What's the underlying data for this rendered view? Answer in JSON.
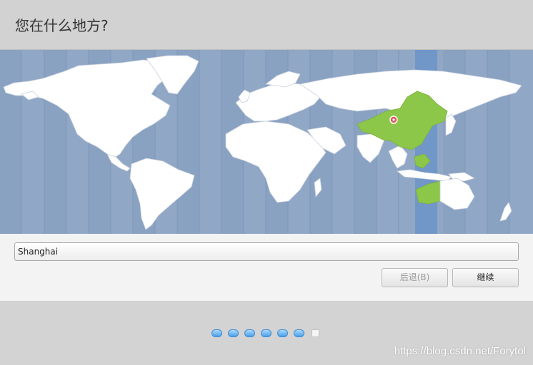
{
  "header": {
    "title": "您在什么地方?"
  },
  "map": {
    "selected_timezone_color": "#6e96c8",
    "selected_region_color": "#8dc74a",
    "land_color": "#ffffff",
    "ocean_color": "#90a7c6",
    "pin_icon": "location-pin-icon"
  },
  "location": {
    "value": "Shanghai"
  },
  "buttons": {
    "back_label": "后退(B)",
    "continue_label": "继续"
  },
  "progress": {
    "total_steps": 7,
    "current_step": 7
  },
  "watermark": {
    "text": "https://blog.csdn.net/Forytol"
  }
}
